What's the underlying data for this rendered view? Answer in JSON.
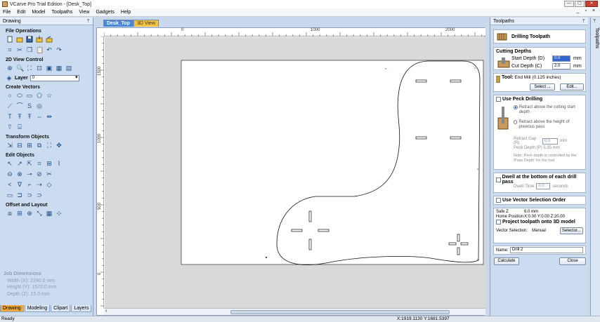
{
  "window": {
    "title": "VCarve Pro Trial Edition - [Desk_Top]",
    "buttons": [
      "—",
      "▢",
      "✕"
    ]
  },
  "menu": {
    "items": [
      "File",
      "Edit",
      "Model",
      "Toolpaths",
      "View",
      "Gadgets",
      "Help"
    ],
    "controls": "_ ▫ ×"
  },
  "left_panel": {
    "title": "Drawing",
    "pin": "ᛘ",
    "sections": {
      "file_operations": "File Operations",
      "view_control": "2D View Control",
      "create_vectors": "Create Vectors",
      "transform": "Transform Objects",
      "edit": "Edit Objects",
      "offset": "Offset and Layout"
    },
    "layer_label": "Layer",
    "layer_value": "0",
    "job_dims": {
      "title": "Job Dimensions",
      "width": "Width  (X): 2240.0 mm",
      "height": "Height (Y): 1570.0 mm",
      "depth": "Depth  (Z): 15.0 mm"
    },
    "tabs": [
      "Drawing",
      "Modeling",
      "Clipart",
      "Layers"
    ]
  },
  "doc_tabs": [
    "Desk_Top",
    "3D View"
  ],
  "rulers": {
    "h_labels": [
      "0",
      "1000",
      "2000"
    ],
    "v_labels": [
      "1500",
      "1000",
      "500",
      "0"
    ]
  },
  "right_panel": {
    "title": "Toolpaths",
    "pin": "ᛘ",
    "header": "Drilling Toolpath",
    "cutting_depths": {
      "title": "Cutting Depths",
      "start_label": "Start Depth (D)",
      "start_value": "0.0",
      "cut_label": "Cut Depth (C)",
      "cut_value": "2.0",
      "unit": "mm"
    },
    "tool": {
      "label": "Tool:",
      "value": "End Mill (0.125 inches)",
      "select": "Select ...",
      "edit": "Edit..."
    },
    "peck": {
      "label": "Use Peck Drilling",
      "opt1": "Retract above the cutting start depth",
      "opt2": "Retract above the height of previous pass",
      "gap_label": "Retract Gap (R)",
      "gap_value": "0.0",
      "gap_unit": "mm",
      "peck_depth": "Peck Depth (P)   5.35 mm",
      "note": "Note: Peck depth is controlled by the 'Pass Depth' for the tool"
    },
    "dwell": {
      "label": "Dwell at the bottom of each drill pass",
      "time_label": "Dwell Time",
      "time_value": "0.0",
      "time_unit": "seconds"
    },
    "vector_order": "Use Vector Selection Order",
    "info": {
      "safe_z": "Safe Z",
      "safe_z_value": "6.0 mm",
      "home": "Home Position",
      "home_value": "X:0.00 Y:0.00 Z:20.00"
    },
    "project": "Project toolpath onto 3D model",
    "vector_selection": {
      "label": "Vector Selection:",
      "value": "Manual",
      "button": "Selector..."
    },
    "name": {
      "label": "Name:",
      "value": "Drill 2"
    },
    "calculate": "Calculate",
    "close": "Close",
    "side_tab": "Toolpaths"
  },
  "status": {
    "left": "Ready",
    "coords": "X:1919.1130 Y:1681.5397"
  }
}
